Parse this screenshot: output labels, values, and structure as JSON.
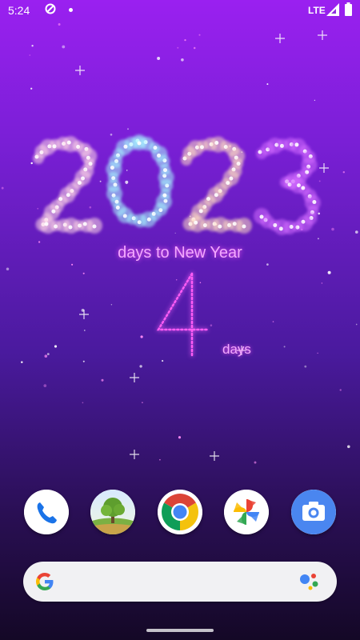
{
  "status_bar": {
    "time": "5:24",
    "network": "LTE",
    "sync_icon": "sync-icon",
    "signal_icon": "signal-icon",
    "battery_icon": "battery-icon"
  },
  "wallpaper": {
    "year_digits": [
      "2",
      "0",
      "2",
      "3"
    ],
    "year_digit_colors": [
      "#ffd7e6",
      "#a6f7ff",
      "#ffdcc2",
      "#d36cff"
    ],
    "countdown_label": "days to New Year",
    "days_remaining": "4",
    "days_unit": "days",
    "glow_color": "#ff5cf5"
  },
  "dock": {
    "apps": [
      {
        "name": "Phone",
        "icon": "phone-icon"
      },
      {
        "name": "Live Wallpaper",
        "icon": "wallpaper-tree-icon"
      },
      {
        "name": "Chrome",
        "icon": "chrome-icon"
      },
      {
        "name": "Photos",
        "icon": "photos-icon"
      },
      {
        "name": "Camera",
        "icon": "camera-icon"
      }
    ]
  },
  "search": {
    "google_icon": "google-g-icon",
    "assistant_icon": "assistant-icon"
  }
}
